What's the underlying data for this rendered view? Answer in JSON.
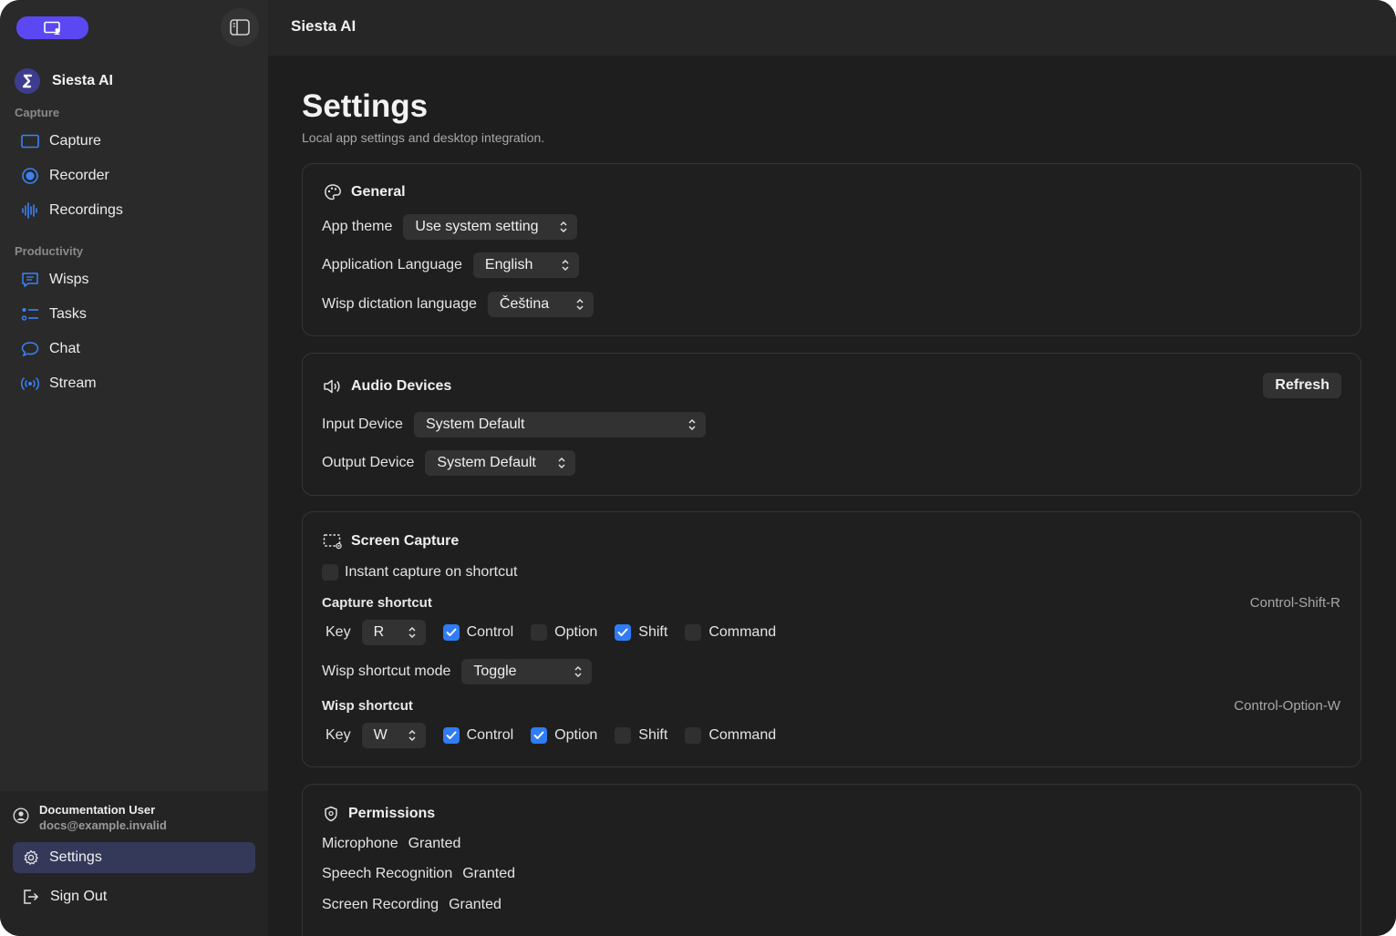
{
  "window": {
    "title": "Siesta AI"
  },
  "sidebar": {
    "app_name": "Siesta AI",
    "sections": [
      {
        "label": "Capture",
        "items": [
          {
            "label": "Capture",
            "icon": "capture-icon"
          },
          {
            "label": "Recorder",
            "icon": "record-icon"
          },
          {
            "label": "Recordings",
            "icon": "waveform-icon"
          }
        ]
      },
      {
        "label": "Productivity",
        "items": [
          {
            "label": "Wisps",
            "icon": "message-icon"
          },
          {
            "label": "Tasks",
            "icon": "tasks-icon"
          },
          {
            "label": "Chat",
            "icon": "chat-bubble-icon"
          },
          {
            "label": "Stream",
            "icon": "broadcast-icon"
          }
        ]
      }
    ],
    "user": {
      "name": "Documentation User",
      "email": "docs@example.invalid"
    },
    "settings_label": "Settings",
    "signout_label": "Sign Out"
  },
  "page": {
    "title": "Settings",
    "subtitle": "Local app settings and desktop integration."
  },
  "general": {
    "title": "General",
    "app_theme_label": "App theme",
    "app_theme_value": "Use system setting",
    "app_language_label": "Application Language",
    "app_language_value": "English",
    "dictation_label": "Wisp dictation language",
    "dictation_value": "Čeština"
  },
  "audio": {
    "title": "Audio Devices",
    "refresh_label": "Refresh",
    "input_label": "Input Device",
    "input_value": "System Default",
    "output_label": "Output Device",
    "output_value": "System Default"
  },
  "screen_capture": {
    "title": "Screen Capture",
    "instant_label": "Instant capture on shortcut",
    "instant_checked": false,
    "capture_shortcut_label": "Capture shortcut",
    "capture_shortcut_value": "Control-Shift-R",
    "key_label": "Key",
    "capture_key": "R",
    "capture_modifiers": [
      {
        "label": "Control",
        "checked": true
      },
      {
        "label": "Option",
        "checked": false
      },
      {
        "label": "Shift",
        "checked": true
      },
      {
        "label": "Command",
        "checked": false
      }
    ],
    "wisp_mode_label": "Wisp shortcut mode",
    "wisp_mode_value": "Toggle",
    "wisp_shortcut_label": "Wisp shortcut",
    "wisp_shortcut_value": "Control-Option-W",
    "wisp_key": "W",
    "wisp_modifiers": [
      {
        "label": "Control",
        "checked": true
      },
      {
        "label": "Option",
        "checked": true
      },
      {
        "label": "Shift",
        "checked": false
      },
      {
        "label": "Command",
        "checked": false
      }
    ]
  },
  "permissions": {
    "title": "Permissions",
    "items": [
      {
        "label": "Microphone",
        "status": "Granted"
      },
      {
        "label": "Speech Recognition",
        "status": "Granted"
      },
      {
        "label": "Screen Recording",
        "status": "Granted"
      }
    ]
  },
  "colors": {
    "accent": "#2f7cf6",
    "brand": "#5b48f2",
    "icon_blue": "#3b82f6"
  }
}
